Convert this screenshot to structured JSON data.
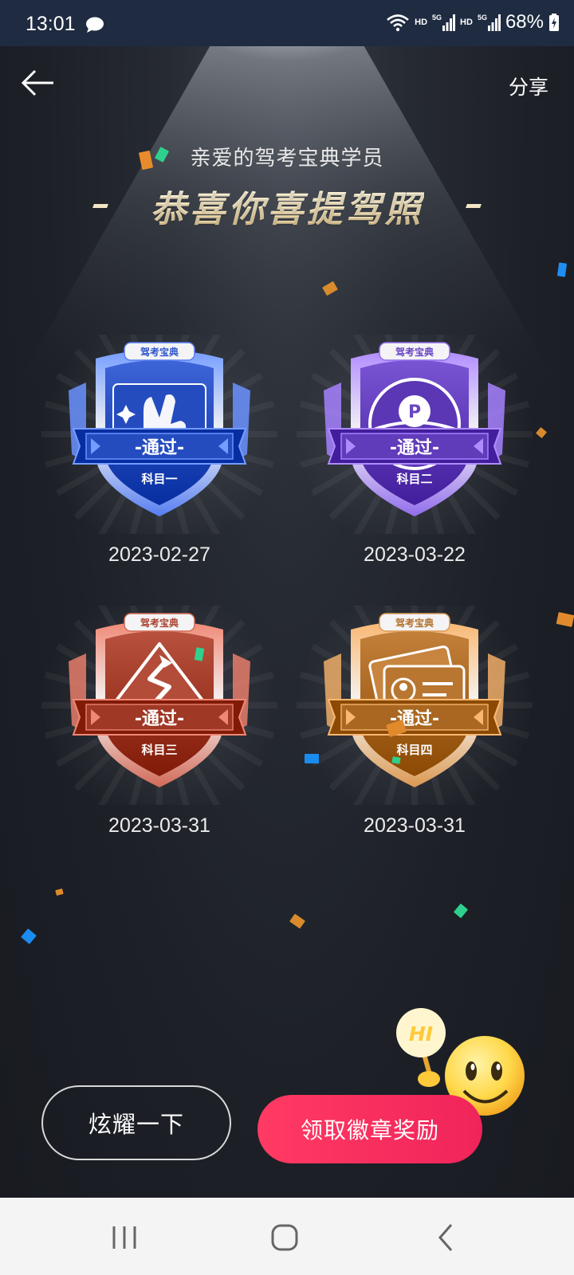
{
  "status_bar": {
    "time": "13:01",
    "net1": "HD",
    "sig1": "5G",
    "net2": "HD",
    "sig2": "5G",
    "battery": "68%",
    "icons": [
      "message-icon",
      "wifi-icon",
      "signal-icon",
      "signal-icon",
      "battery-icon"
    ]
  },
  "nav": {
    "share_label": "分享",
    "back_icon": "back-arrow-icon"
  },
  "header": {
    "greeting": "亲爱的驾考宝典学员",
    "title": "恭喜你喜提驾照"
  },
  "badges": [
    {
      "brand": "驾考宝典",
      "status": "-通过-",
      "subject": "科目一",
      "date": "2023-02-27",
      "icon": "victory-hand-icon",
      "color": "#2f56c9"
    },
    {
      "brand": "驾考宝典",
      "status": "-通过-",
      "subject": "科目二",
      "date": "2023-03-22",
      "icon": "parking-wheel-icon",
      "color": "#6a45c4"
    },
    {
      "brand": "驾考宝典",
      "status": "-通过-",
      "subject": "科目三",
      "date": "2023-03-31",
      "icon": "road-sign-icon",
      "color": "#a9422f"
    },
    {
      "brand": "驾考宝典",
      "status": "-通过-",
      "subject": "科目四",
      "date": "2023-03-31",
      "icon": "license-card-icon",
      "color": "#b3712b"
    }
  ],
  "actions": {
    "show_off": "炫耀一下",
    "claim": "领取徽章奖励",
    "mascot_text": "HI"
  },
  "system_nav": [
    "recent-apps-icon",
    "home-icon",
    "back-icon"
  ]
}
